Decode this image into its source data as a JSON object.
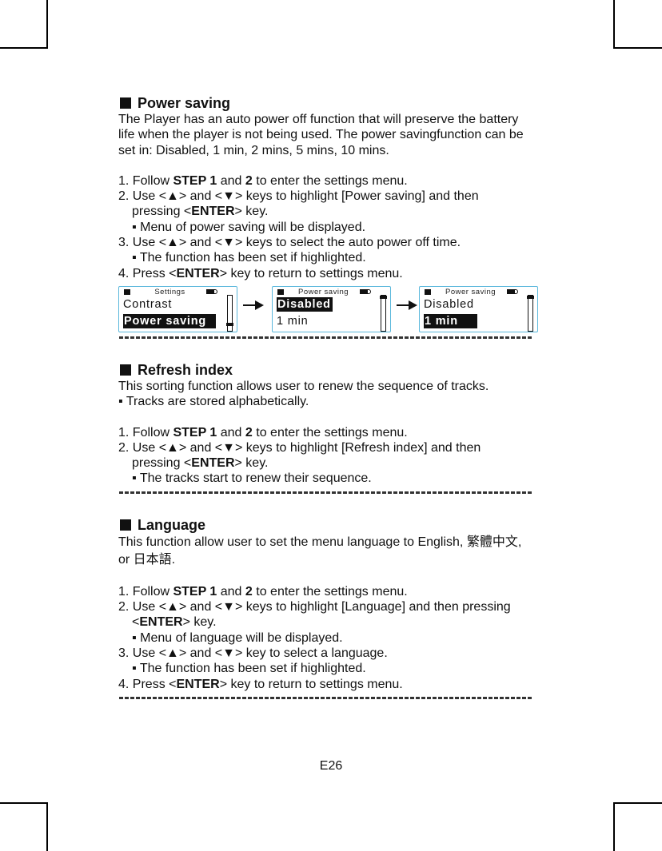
{
  "sections": {
    "power": {
      "title": "Power saving",
      "intro": [
        "The Player has an auto power off function that will preserve the battery",
        "life when the player is not being used. The power savingfunction can be",
        "set in: Disabled, 1 min, 2 mins, 5 mins, 10 mins."
      ],
      "steps": [
        {
          "num": "1.",
          "pre": " Follow ",
          "b1": "STEP 1",
          "mid": " and ",
          "b2": "2",
          "post": " to enter the settings menu."
        },
        {
          "num": "2.",
          "text": " Use <▲> and <▼> keys to highlight [Power saving] and then",
          "cont_pre": "pressing <",
          "cont_b": "ENTER",
          "cont_post": "> key.",
          "bullet": "▪ Menu of power saving will be displayed."
        },
        {
          "num": "3.",
          "text": " Use <▲> and <▼> keys to select the auto power off time.",
          "bullet": "▪ The function has been set if highlighted."
        },
        {
          "num": "4.",
          "pre": " Press <",
          "b": "ENTER",
          "post": "> key to return to settings menu."
        }
      ],
      "screens": [
        {
          "header": "Settings",
          "line1": "Contrast",
          "line2": "Power saving",
          "highlight": 2,
          "scroll_position": "bottom"
        },
        {
          "header": "Power saving",
          "line1": "Disabled",
          "line2": "1 min",
          "highlight": 1,
          "scroll_position": "top"
        },
        {
          "header": "Power saving",
          "line1": "Disabled",
          "line2": "1 min",
          "highlight": 2,
          "scroll_position": "top"
        }
      ]
    },
    "refresh": {
      "title": "Refresh index",
      "intro": "This sorting function allows user to renew the sequence of tracks.",
      "note": "▪ Tracks are stored alphabetically.",
      "steps": [
        {
          "num": "1.",
          "pre": " Follow ",
          "b1": "STEP 1",
          "mid": " and ",
          "b2": "2",
          "post": " to enter the settings menu."
        },
        {
          "num": "2.",
          "text": " Use <▲> and <▼> keys to highlight [Refresh index] and then",
          "cont_pre": "pressing <",
          "cont_b": "ENTER",
          "cont_post": "> key.",
          "bullet": "▪ The tracks start to renew their sequence."
        }
      ]
    },
    "language": {
      "title": "Language",
      "intro1": "This function allow user to set the menu language to English,  繁體中文,",
      "intro2": "or  日本語.",
      "steps": [
        {
          "num": "1.",
          "pre": " Follow ",
          "b1": "STEP 1",
          "mid": " and ",
          "b2": "2",
          "post": " to enter the settings menu."
        },
        {
          "num": "2.",
          "text": " Use <▲> and <▼> keys to highlight [Language] and then pressing",
          "cont_pre": "<",
          "cont_b": "ENTER",
          "cont_post": "> key.",
          "bullet": "▪ Menu of language will be displayed."
        },
        {
          "num": "3.",
          "text": " Use <▲> and <▼> key to select a language.",
          "bullet": "▪ The function has been set if highlighted."
        },
        {
          "num": "4.",
          "pre": " Press <",
          "b": "ENTER",
          "post": "> key to return to settings menu."
        }
      ]
    }
  },
  "page_number": "E26"
}
